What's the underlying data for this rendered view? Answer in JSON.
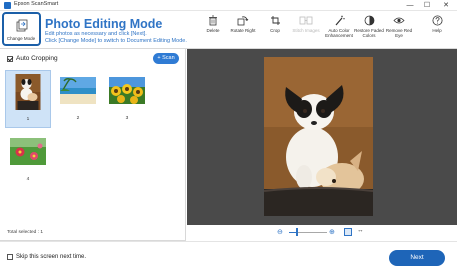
{
  "window": {
    "title": "Epson ScanSmart",
    "controls": {
      "minimize": "—",
      "maximize": "☐",
      "close": "✕"
    }
  },
  "header": {
    "change_mode_label": "Change Mode",
    "mode_title": "Photo Editing Mode",
    "mode_desc_1": "Edit photos as necessary and click [Next].",
    "mode_desc_2": "Click [Change Mode] to switch to Document Editing Mode."
  },
  "toolbar": {
    "delete": "Delete",
    "rotate_right": "Rotate Right",
    "crop": "Crop",
    "stitch_images": "Stitch Images",
    "auto_color_1": "Auto Color",
    "auto_color_2": "Enhancement",
    "restore_faded_1": "Restore Faded",
    "restore_faded_2": "Colors",
    "remove_red_eye_1": "Remove Red",
    "remove_red_eye_2": "Eye",
    "help": "Help"
  },
  "left_panel": {
    "auto_cropping_label": "Auto Cropping",
    "scan_label": "+ Scan",
    "thumbnails": [
      {
        "num": "1",
        "subject": "dogs",
        "selected": true
      },
      {
        "num": "2",
        "subject": "beach",
        "selected": false
      },
      {
        "num": "3",
        "subject": "sunflowers",
        "selected": false
      },
      {
        "num": "4",
        "subject": "flowers",
        "selected": false
      }
    ],
    "total_selected": "Total selected : 1"
  },
  "preview": {
    "zoom_out_icon": "⊖",
    "zoom_in_icon": "⊕",
    "expand_icon": "↔",
    "zoom_level": 0.2
  },
  "footer": {
    "skip_label": "Skip this screen next time.",
    "next_label": "Next"
  },
  "colors": {
    "accent": "#2f74c5",
    "mode_button_border": "#1b5fa8",
    "next_button": "#1e65b8",
    "preview_bg": "#4a4a4a",
    "selection": "#cfe3f7"
  }
}
